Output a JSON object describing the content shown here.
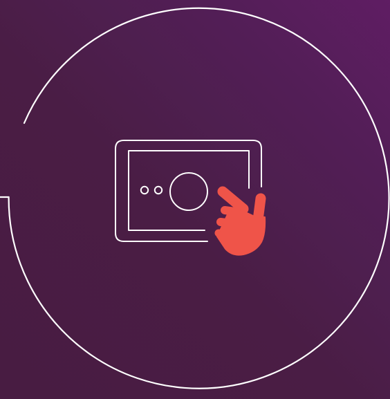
{
  "illustration": {
    "subject": "tablet-touch-icon",
    "colors": {
      "background_top_right": "#5f1d63",
      "background_bottom": "#481c42",
      "line": "#ffffff",
      "hand": "#ef5449"
    }
  }
}
